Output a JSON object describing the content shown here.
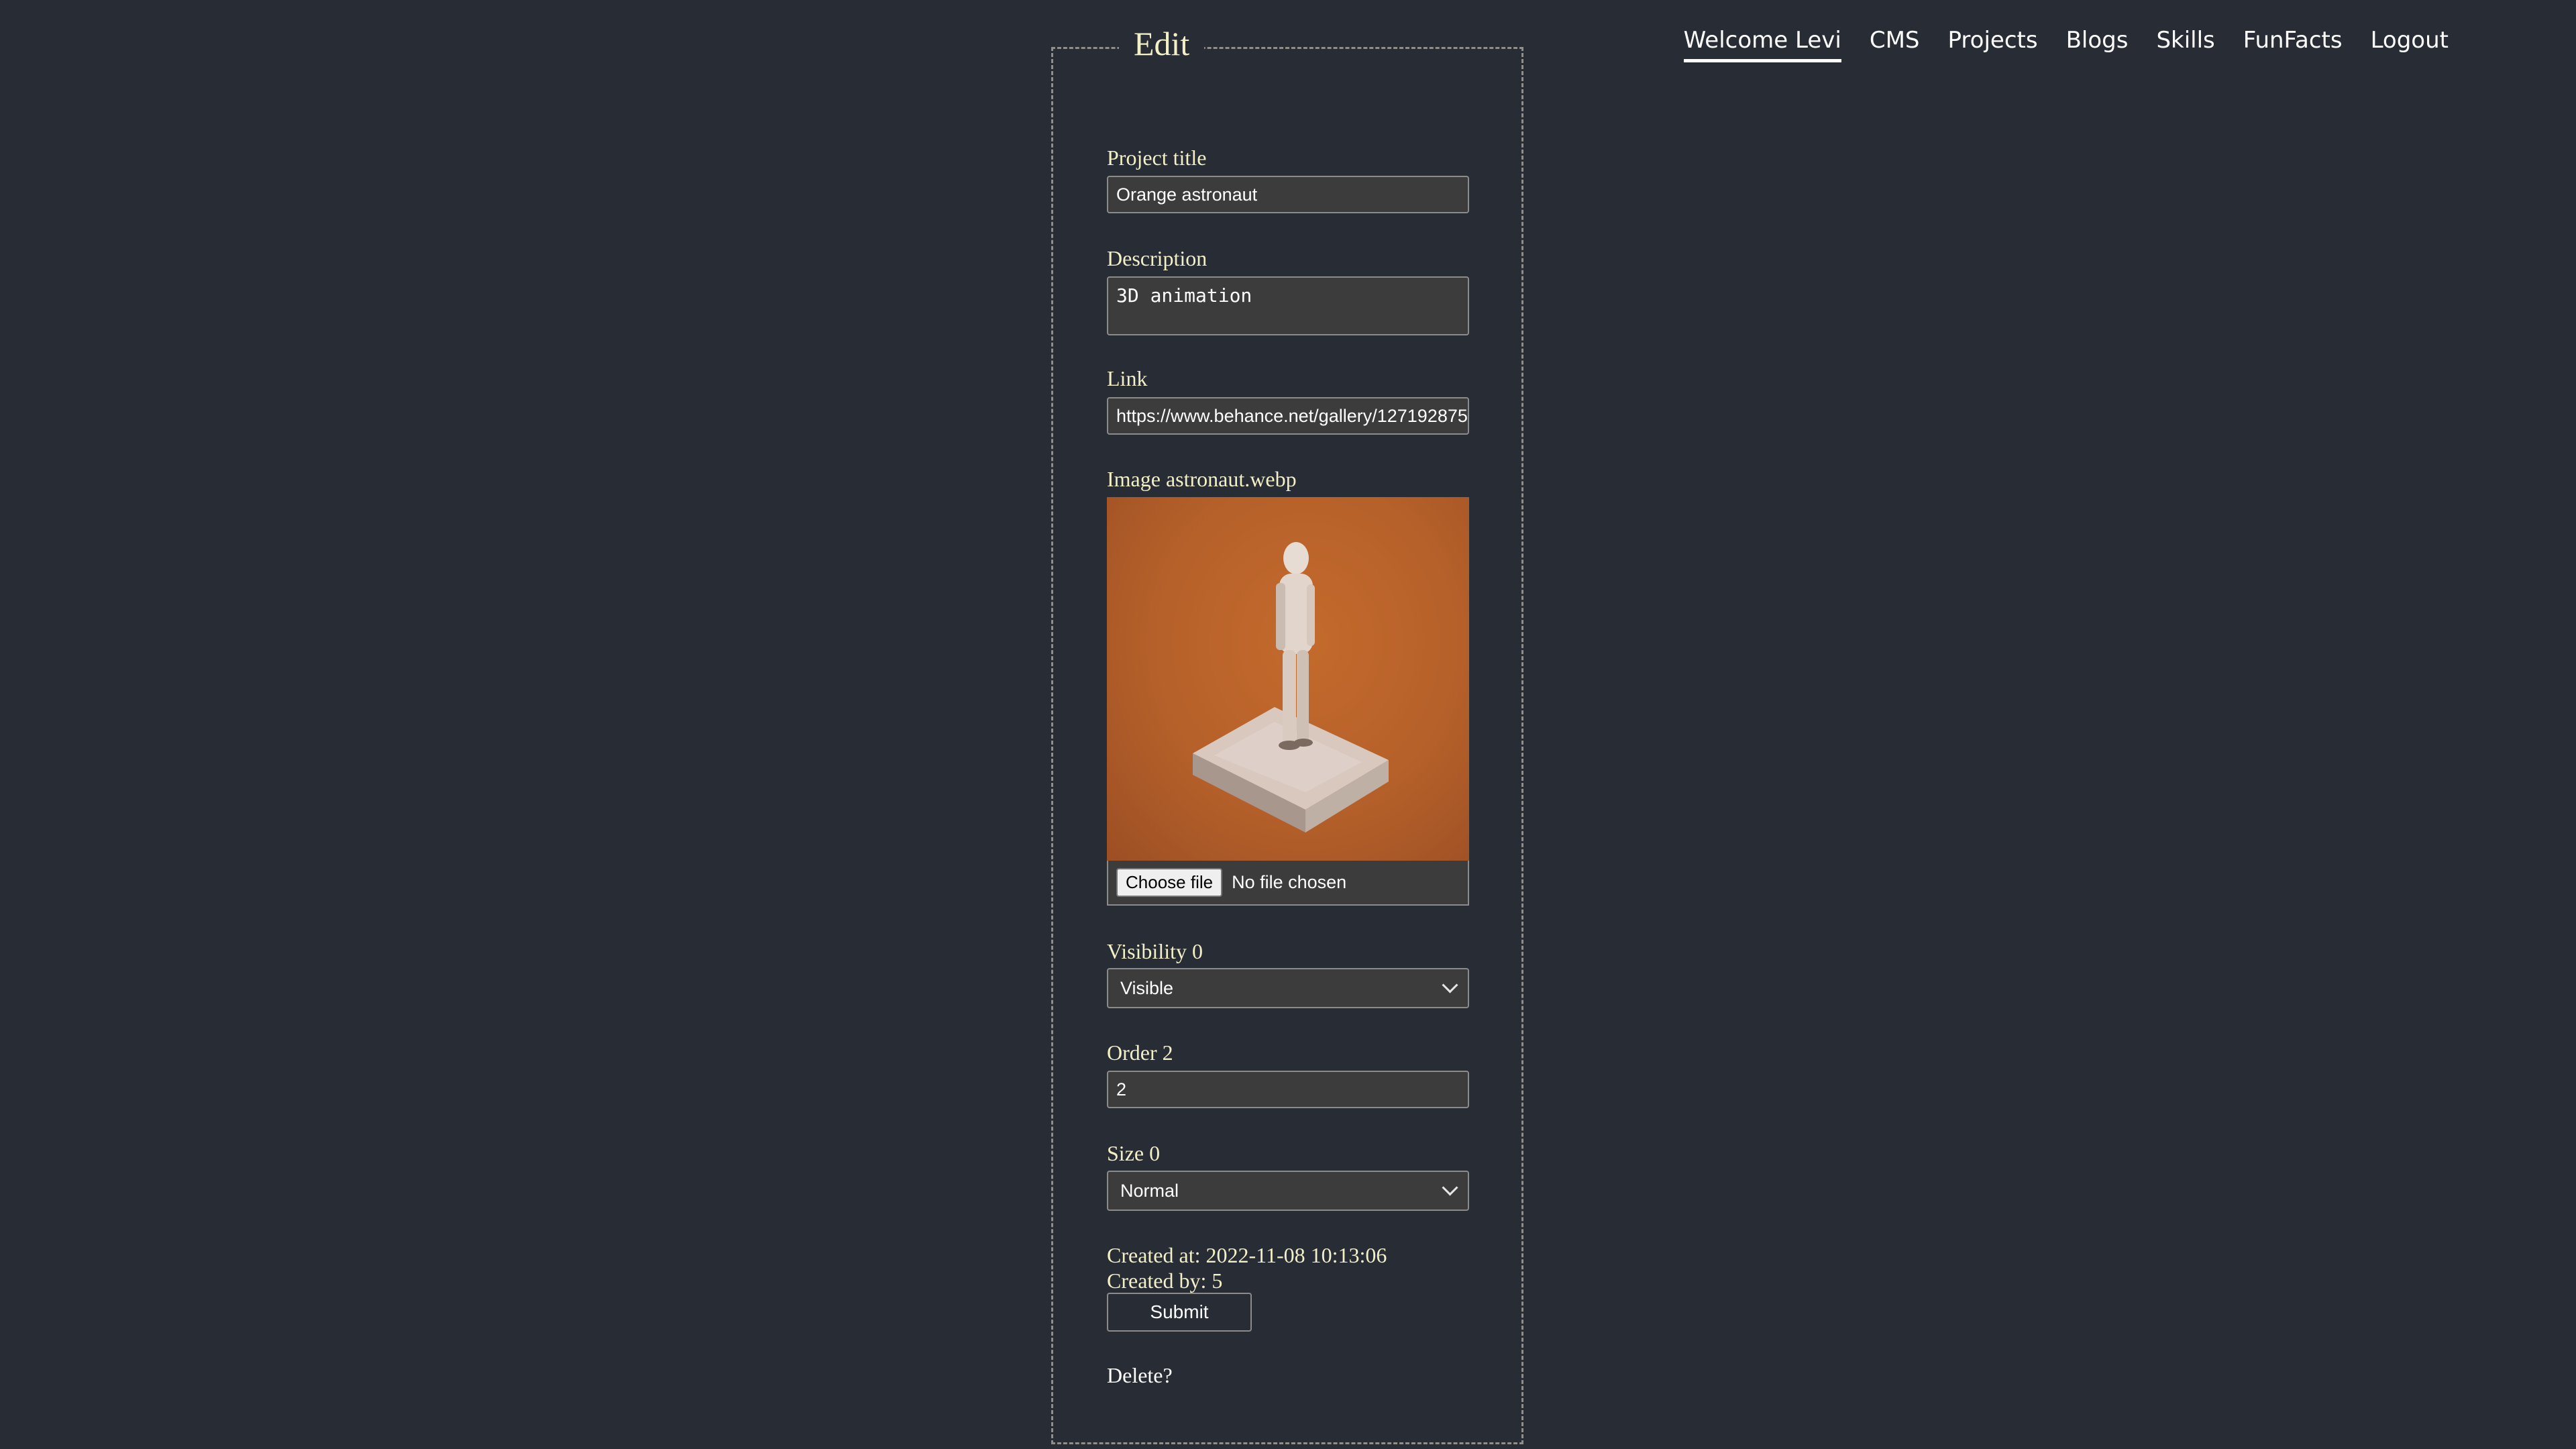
{
  "nav": {
    "items": [
      {
        "label": "Welcome Levi",
        "active": true
      },
      {
        "label": "CMS"
      },
      {
        "label": "Projects"
      },
      {
        "label": "Blogs"
      },
      {
        "label": "Skills"
      },
      {
        "label": "FunFacts"
      },
      {
        "label": "Logout"
      }
    ]
  },
  "form": {
    "legend": "Edit",
    "title_label": "Project title",
    "title_value": "Orange astronaut",
    "description_label": "Description",
    "description_value": "3D animation",
    "link_label": "Link",
    "link_value": "https://www.behance.net/gallery/127192875",
    "image_label": "Image astronaut.webp",
    "choose_file_label": "Choose file",
    "no_file_text": "No file chosen",
    "visibility_label": "Visibility 0",
    "visibility_value": "Visible",
    "order_label": "Order 2",
    "order_value": "2",
    "size_label": "Size 0",
    "size_value": "Normal",
    "created_at": "Created at: 2022-11-08 10:13:06",
    "created_by": "Created by: 5",
    "submit_label": "Submit",
    "delete_label": "Delete?"
  },
  "colors": {
    "background": "#272c35",
    "label_text": "#f3efc6",
    "input_bg": "#3c3c3c",
    "image_orange": "#b5602a"
  }
}
